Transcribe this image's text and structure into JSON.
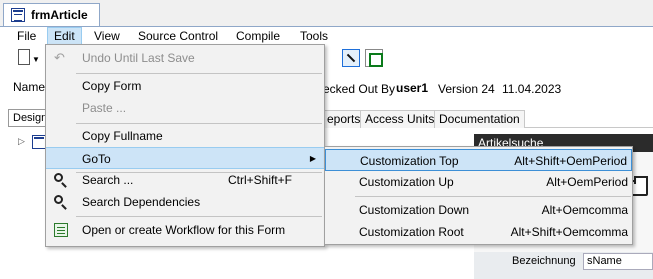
{
  "document_tab": {
    "title": "frmArticle"
  },
  "menubar": {
    "items": [
      "File",
      "Edit",
      "View",
      "Source Control",
      "Compile",
      "Tools"
    ]
  },
  "info": {
    "name_label": "Name",
    "checked_out": "ecked Out By",
    "user": "user1",
    "version": "Version 24",
    "date": "11.04.2023"
  },
  "tabs": {
    "design": "Design",
    "items": [
      "eports",
      "Access Units",
      "Documentation"
    ]
  },
  "designer": {
    "title": "Artikelsuche",
    "field_label": "Bezeichnung",
    "field_value": "sName"
  },
  "edit_menu": {
    "items": [
      {
        "label": "Undo Until Last Save",
        "shortcut": "",
        "disabled": true,
        "icon": "undo-icon"
      },
      {
        "label": "Copy Form",
        "shortcut": "",
        "disabled": false,
        "icon": ""
      },
      {
        "label": "Paste ...",
        "shortcut": "",
        "disabled": true,
        "icon": ""
      },
      {
        "label": "Copy Fullname",
        "shortcut": "",
        "disabled": false,
        "icon": ""
      },
      {
        "label": "GoTo",
        "shortcut": "",
        "disabled": false,
        "icon": "",
        "submenu": true
      },
      {
        "label": "Search ...",
        "shortcut": "Ctrl+Shift+F",
        "disabled": false,
        "icon": "magnifier-icon"
      },
      {
        "label": "Search Dependencies",
        "shortcut": "",
        "disabled": false,
        "icon": "magnifier-icon"
      },
      {
        "label": "Open or create Workflow for this Form",
        "shortcut": "",
        "disabled": false,
        "icon": "workflow-icon"
      }
    ]
  },
  "goto_submenu": {
    "items": [
      {
        "label": "Customization Top",
        "shortcut": "Alt+Shift+OemPeriod"
      },
      {
        "label": "Customization Up",
        "shortcut": "Alt+OemPeriod"
      },
      {
        "label": "Customization Down",
        "shortcut": "Alt+Oemcomma"
      },
      {
        "label": "Customization Root",
        "shortcut": "Alt+Shift+Oemcomma"
      }
    ]
  },
  "colors": {
    "highlight": "#cde4f7",
    "highlight_border": "#3d8fd6",
    "disabled_text": "#8d8d8d"
  }
}
